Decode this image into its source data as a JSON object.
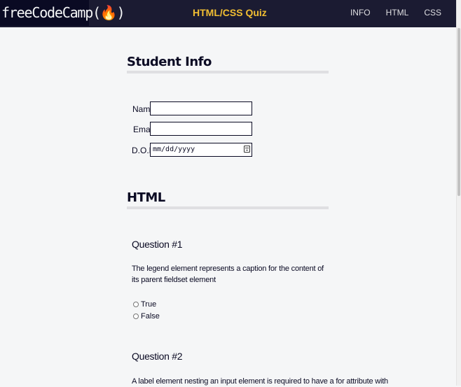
{
  "navbar": {
    "logo": "freeCodeCamp(🔥)",
    "title": "HTML/CSS Quiz",
    "links": [
      "INFO",
      "HTML",
      "CSS"
    ]
  },
  "student_info": {
    "heading": "Student Info",
    "fields": {
      "name_label": "Name:",
      "email_label": "Email:",
      "dob_label": "D.O.B.",
      "dob_placeholder": "mm/dd/yyyy"
    }
  },
  "html_section": {
    "heading": "HTML",
    "questions": [
      {
        "heading": "Question #1",
        "text": "The legend element represents a caption for the content of its parent fieldset element",
        "options": [
          "True",
          "False"
        ]
      },
      {
        "heading": "Question #2",
        "text": "A label element nesting an input element is required to have a for attribute with"
      }
    ]
  },
  "colors": {
    "navbar_bg": "#1b1b32",
    "title": "#f1be32",
    "page_bg": "#f5f6f7"
  }
}
